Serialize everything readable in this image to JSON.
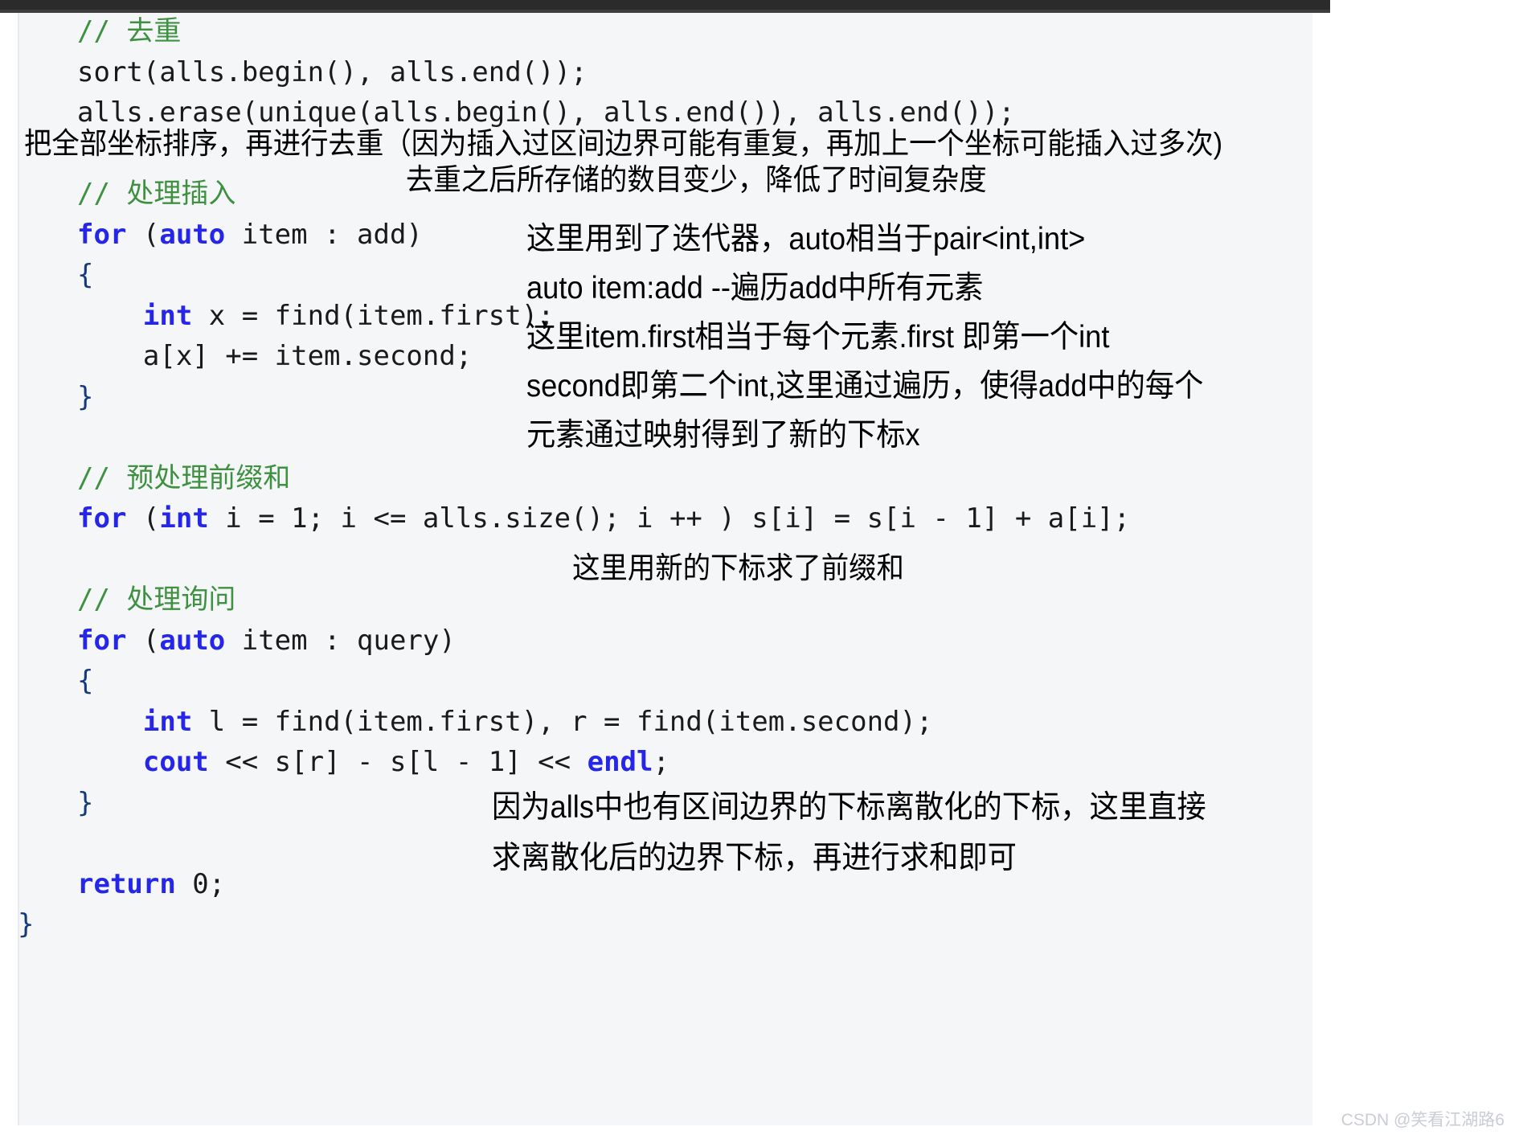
{
  "meta": {
    "colors": {
      "code_background": "#f4f6f8",
      "top_bar": "#2b2b2b",
      "comment_green": "#3f9142",
      "keyword_blue": "#2626e8",
      "text_black": "#1a1a1a",
      "watermark_gray": "#c9cdd4"
    }
  },
  "code": {
    "language": "cpp",
    "lines": [
      {
        "indent": 0,
        "tokens": [
          {
            "t": "// 去重",
            "c": "cmt"
          }
        ]
      },
      {
        "indent": 0,
        "tokens": [
          {
            "t": "sort(alls.begin(), alls.end());",
            "c": "id"
          }
        ]
      },
      {
        "indent": 0,
        "tokens": [
          {
            "t": "alls.erase(unique(alls.begin(), alls.end()), alls.end());",
            "c": "id"
          }
        ]
      },
      {
        "indent": 0,
        "tokens": [
          {
            "t": "",
            "c": "id"
          }
        ]
      },
      {
        "indent": 0,
        "tokens": [
          {
            "t": "// 处理插入",
            "c": "cmt"
          }
        ]
      },
      {
        "indent": 0,
        "tokens": [
          {
            "t": "for",
            "c": "kw"
          },
          {
            "t": " (",
            "c": "id"
          },
          {
            "t": "auto",
            "c": "kw"
          },
          {
            "t": " item : add)",
            "c": "id"
          }
        ]
      },
      {
        "indent": 0,
        "tokens": [
          {
            "t": "{",
            "c": "blk"
          }
        ]
      },
      {
        "indent": 4,
        "tokens": [
          {
            "t": "int",
            "c": "kw"
          },
          {
            "t": " x = find(item.first);",
            "c": "id"
          }
        ]
      },
      {
        "indent": 4,
        "tokens": [
          {
            "t": "a[x] += item.second;",
            "c": "id"
          }
        ]
      },
      {
        "indent": 0,
        "tokens": [
          {
            "t": "}",
            "c": "blk"
          }
        ]
      },
      {
        "indent": 0,
        "tokens": [
          {
            "t": "",
            "c": "id"
          }
        ]
      },
      {
        "indent": 0,
        "tokens": [
          {
            "t": "// 预处理前缀和",
            "c": "cmt"
          }
        ]
      },
      {
        "indent": 0,
        "tokens": [
          {
            "t": "for",
            "c": "kw"
          },
          {
            "t": " (",
            "c": "id"
          },
          {
            "t": "int",
            "c": "kw"
          },
          {
            "t": " i = 1; i <= alls.size(); i ++ ) s[i] = s[i - 1] + a[i];",
            "c": "id"
          }
        ]
      },
      {
        "indent": 0,
        "tokens": [
          {
            "t": "",
            "c": "id"
          }
        ]
      },
      {
        "indent": 0,
        "tokens": [
          {
            "t": "// 处理询问",
            "c": "cmt"
          }
        ]
      },
      {
        "indent": 0,
        "tokens": [
          {
            "t": "for",
            "c": "kw"
          },
          {
            "t": " (",
            "c": "id"
          },
          {
            "t": "auto",
            "c": "kw"
          },
          {
            "t": " item : query)",
            "c": "id"
          }
        ]
      },
      {
        "indent": 0,
        "tokens": [
          {
            "t": "{",
            "c": "blk"
          }
        ]
      },
      {
        "indent": 4,
        "tokens": [
          {
            "t": "int",
            "c": "kw"
          },
          {
            "t": " l = find(item.first), r = find(item.second);",
            "c": "id"
          }
        ]
      },
      {
        "indent": 4,
        "tokens": [
          {
            "t": "cout",
            "c": "kw"
          },
          {
            "t": " << s[r] - s[l - 1] << ",
            "c": "id"
          },
          {
            "t": "endl",
            "c": "kw"
          },
          {
            "t": ";",
            "c": "id"
          }
        ]
      },
      {
        "indent": 0,
        "tokens": [
          {
            "t": "}",
            "c": "blk"
          }
        ]
      },
      {
        "indent": 0,
        "tokens": [
          {
            "t": "",
            "c": "id"
          }
        ]
      },
      {
        "indent": 0,
        "tokens": [
          {
            "t": "return",
            "c": "kw"
          },
          {
            "t": " 0;",
            "c": "id"
          }
        ]
      },
      {
        "indent": -1,
        "tokens": [
          {
            "t": "}",
            "c": "blk"
          }
        ]
      }
    ]
  },
  "annotations": {
    "sort_line_1": "把全部坐标排序，再进行去重（因为插入过区间边界可能有重复，再加上一个坐标可能插入过多次)",
    "sort_line_2": "去重之后所存储的数目变少，降低了时间复杂度",
    "iterator_block": [
      "这里用到了迭代器，auto相当于pair<int,int>",
      "auto item:add --遍历add中所有元素",
      "这里item.first相当于每个元素.first 即第一个int",
      "second即第二个int,这里通过遍历，使得add中的每个",
      "元素通过映射得到了新的下标x"
    ],
    "prefix_sum_note": "这里用新的下标求了前缀和",
    "query_block": [
      "因为alls中也有区间边界的下标离散化的下标，这里直接",
      "求离散化后的边界下标，再进行求和即可"
    ]
  },
  "watermark": {
    "text": "CSDN @笑看江湖路6"
  }
}
